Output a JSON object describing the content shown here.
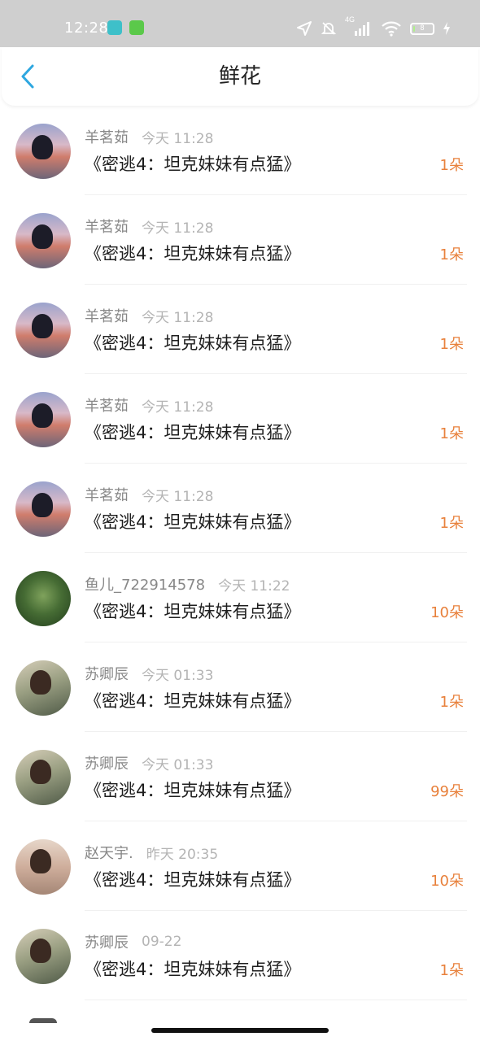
{
  "status_bar": {
    "time": "12:28",
    "network": "4G",
    "battery_level": "8",
    "battery_fill_fraction": 0.08,
    "icons": [
      "location-icon",
      "mute-bell-icon",
      "signal-icon",
      "wifi-icon",
      "battery-icon",
      "charging-icon"
    ]
  },
  "header": {
    "title": "鲜花",
    "back_icon": "chevron-left-icon"
  },
  "colors": {
    "count_orange": "#e8813c",
    "back_blue": "#2ea7e0",
    "name_gray": "#888888",
    "time_gray": "#b4b4b4"
  },
  "items": [
    {
      "user": "羊茗茹",
      "time": "今天 11:28",
      "title": "《密逃4：坦克妹妹有点猛》",
      "count": "1朵",
      "avatar": "avatar-1"
    },
    {
      "user": "羊茗茹",
      "time": "今天 11:28",
      "title": "《密逃4：坦克妹妹有点猛》",
      "count": "1朵",
      "avatar": "avatar-1"
    },
    {
      "user": "羊茗茹",
      "time": "今天 11:28",
      "title": "《密逃4：坦克妹妹有点猛》",
      "count": "1朵",
      "avatar": "avatar-1"
    },
    {
      "user": "羊茗茹",
      "time": "今天 11:28",
      "title": "《密逃4：坦克妹妹有点猛》",
      "count": "1朵",
      "avatar": "avatar-1"
    },
    {
      "user": "羊茗茹",
      "time": "今天 11:28",
      "title": "《密逃4：坦克妹妹有点猛》",
      "count": "1朵",
      "avatar": "avatar-1"
    },
    {
      "user": "鱼儿_722914578",
      "time": "今天 11:22",
      "title": "《密逃4：坦克妹妹有点猛》",
      "count": "10朵",
      "avatar": "avatar-2"
    },
    {
      "user": "苏卿辰",
      "time": "今天 01:33",
      "title": "《密逃4：坦克妹妹有点猛》",
      "count": "1朵",
      "avatar": "avatar-3"
    },
    {
      "user": "苏卿辰",
      "time": "今天 01:33",
      "title": "《密逃4：坦克妹妹有点猛》",
      "count": "99朵",
      "avatar": "avatar-3"
    },
    {
      "user": "赵天宇.",
      "time": "昨天 20:35",
      "title": "《密逃4：坦克妹妹有点猛》",
      "count": "10朵",
      "avatar": "avatar-4"
    },
    {
      "user": "苏卿辰",
      "time": "09-22",
      "title": "《密逃4：坦克妹妹有点猛》",
      "count": "1朵",
      "avatar": "avatar-3"
    }
  ]
}
